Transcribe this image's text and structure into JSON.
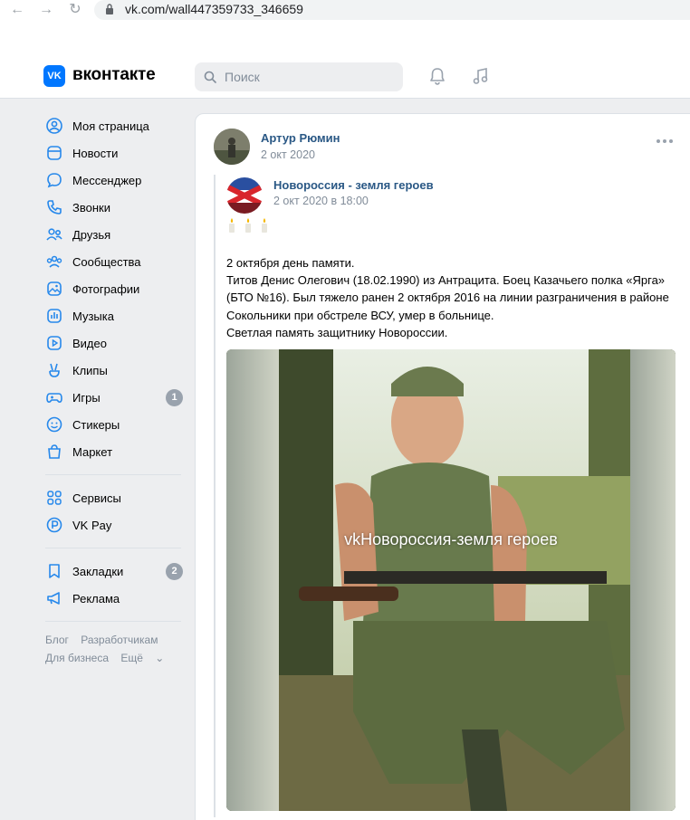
{
  "browser": {
    "back_icon": "arrow-left-icon",
    "forward_icon": "arrow-right-icon",
    "reload_icon": "reload-icon",
    "url": "vk.com/wall447359733_346659"
  },
  "header": {
    "logo_letters": "VK",
    "brand": "вконтакте",
    "search_placeholder": "Поиск"
  },
  "sidebar": {
    "items": [
      {
        "label": "Моя страница",
        "icon": "user-circle-icon"
      },
      {
        "label": "Новости",
        "icon": "newspaper-icon"
      },
      {
        "label": "Мессенджер",
        "icon": "chat-bubble-icon"
      },
      {
        "label": "Звонки",
        "icon": "phone-icon"
      },
      {
        "label": "Друзья",
        "icon": "friends-icon"
      },
      {
        "label": "Сообщества",
        "icon": "communities-icon"
      },
      {
        "label": "Фотографии",
        "icon": "photo-icon"
      },
      {
        "label": "Музыка",
        "icon": "music-bars-icon"
      },
      {
        "label": "Видео",
        "icon": "video-icon"
      },
      {
        "label": "Клипы",
        "icon": "clips-hand-icon"
      },
      {
        "label": "Игры",
        "icon": "gamepad-icon",
        "badge": "1"
      },
      {
        "label": "Стикеры",
        "icon": "smile-icon"
      },
      {
        "label": "Маркет",
        "icon": "shopping-bag-icon"
      }
    ],
    "services": [
      {
        "label": "Сервисы",
        "icon": "services-grid-icon"
      },
      {
        "label": "VK Pay",
        "icon": "vkpay-icon"
      }
    ],
    "extra": [
      {
        "label": "Закладки",
        "icon": "bookmark-icon",
        "badge": "2"
      },
      {
        "label": "Реклама",
        "icon": "megaphone-icon"
      }
    ],
    "footer": {
      "blog": "Блог",
      "developers": "Разработчикам",
      "business": "Для бизнеса",
      "more": "Ещё"
    }
  },
  "post": {
    "author": "Артур Рюмин",
    "date": "2 окт 2020",
    "repost": {
      "source_name": "Новороссия - земля героев",
      "source_date": "2 окт 2020 в 18:00",
      "text_lines": [
        "2 октября день памяти.",
        "Титов Денис Олегович (18.02.1990) из Антрацита. Боец Казачьего полка «Ярга»",
        "(БТО №16). Был тяжело ранен 2 октября 2016 на линии разграничения в районе",
        "Сокольники при обстреле ВСУ, умер в больнице.",
        "Светлая память защитнику Новороссии."
      ],
      "watermark": "vkНовороссия-земля героев"
    }
  },
  "colors": {
    "vk_blue": "#0077ff",
    "link": "#2a5885",
    "muted": "#818c99",
    "page_bg": "#edeef0"
  }
}
